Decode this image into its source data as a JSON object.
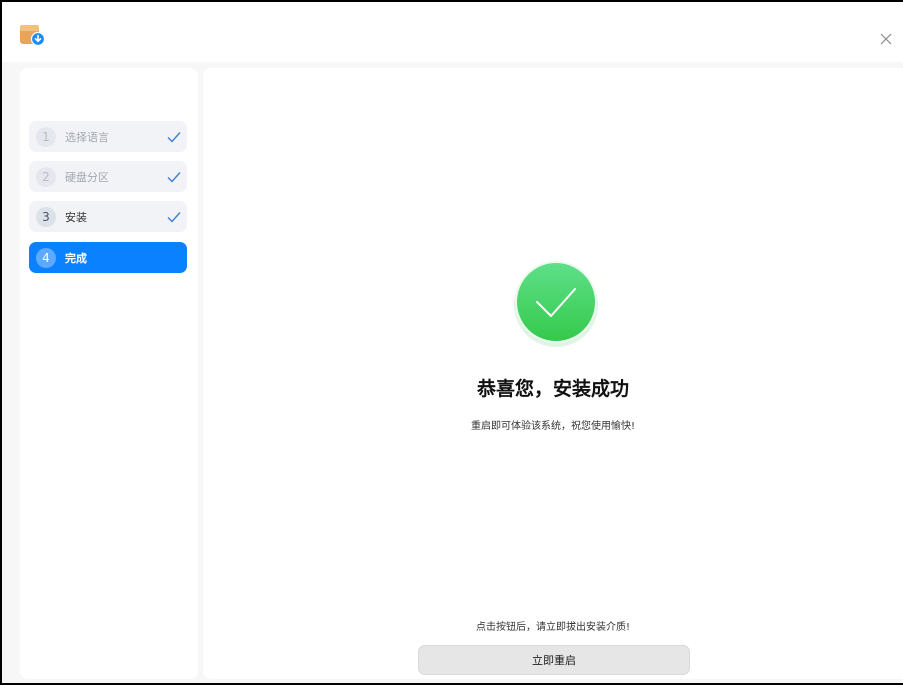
{
  "titlebar": {
    "app_icon": "installer-box-download-icon",
    "close_icon": "close-icon"
  },
  "sidebar": {
    "steps": [
      {
        "number": "1",
        "label": "选择语言",
        "state": "done"
      },
      {
        "number": "2",
        "label": "硬盘分区",
        "state": "done"
      },
      {
        "number": "3",
        "label": "安装",
        "state": "done"
      },
      {
        "number": "4",
        "label": "完成",
        "state": "active"
      }
    ]
  },
  "main": {
    "success_icon": "check-circle-icon",
    "title": "恭喜您，安装成功",
    "subtitle": "重启即可体验该系统，祝您使用愉快!",
    "hint": "点击按钮后，请立即拔出安装介质!",
    "reboot_label": "立即重启"
  },
  "colors": {
    "accent": "#0a81ff",
    "success_green": "#3ed35f",
    "check_mark": "#3f7fd6"
  }
}
